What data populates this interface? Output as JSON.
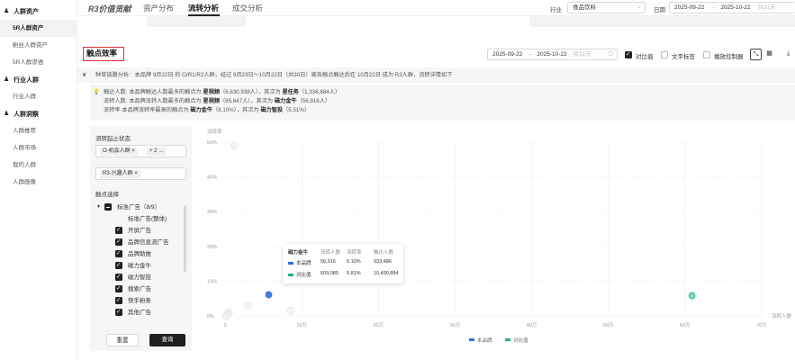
{
  "sidebar": {
    "groups": [
      {
        "label": "人群资产",
        "items": [
          "5R人群资产",
          "粉丝人群资产",
          "5R人群渗透"
        ]
      },
      {
        "label": "行业人群",
        "items": [
          "行业人群"
        ]
      },
      {
        "label": "人群洞察",
        "items": [
          "人群推荐",
          "人群市场",
          "我的人群",
          "人群画像"
        ]
      }
    ],
    "active_item": "5R人群资产"
  },
  "topbar": {
    "brand": "R3价值贡献",
    "tabs": [
      "资产分布",
      "流转分析",
      "成交分析"
    ],
    "active_tab": "流转分析",
    "industry_label": "行业",
    "industry_value": "食品饮料",
    "date_label": "日期",
    "date_start": "2025-09-22",
    "date_sep": "→",
    "date_end": "2025-10-22",
    "date_days": "共31天"
  },
  "section": {
    "title": "触点效率",
    "range_start": "2025-09-22",
    "range_end": "2025-10-22",
    "range_days": "共31天",
    "compare_label": "对比值",
    "text_tag_label": "文字标签",
    "zoom_label": "播放控制器"
  },
  "path_line": {
    "prefix": "种草链路分析:",
    "text": "本品牌 9月22日 的 O/R1/R2人群，经过 9月23日～10月22日（共30日）被各触点触达后在 10月22日 成为 R3人群，流转详情如下"
  },
  "insights": {
    "line1_label": "触达人数:",
    "line1_text": "本品牌触达人数最多的触点为",
    "line1_top": "星視频",
    "line1_top_val": "（6,830,938人）",
    "line1_mid": "，其次为",
    "line1_second": "星任务",
    "line1_second_val": "（1,336,684人）",
    "line2_label": "流转人数:",
    "line2_text": "本品牌流转人数最多的触点为",
    "line2_top": "星視频",
    "line2_top_val": "（85,647人）",
    "line2_mid": "，其次为",
    "line2_second": "磁力金牛",
    "line2_second_val": "（56,916人）",
    "line3_label": "流转率",
    "line3_text": "本品牌流转率最高的触点为",
    "line3_top": "磁力金牛",
    "line3_top_val": "（6.10%）",
    "line3_mid": "，其次为",
    "line3_second": "磁力智投",
    "line3_second_val": "（5.51%）"
  },
  "filters": {
    "start_state_label": "流转起止状态",
    "start_tags": [
      "O-机会人群 ×",
      "+ 2 ..."
    ],
    "end_tags": [
      "R3-兴趣人群 ×"
    ],
    "touch_label": "触点选择",
    "tree_root": "标准广告（8/9）",
    "tree_items": [
      {
        "label": "标准广告(整体)",
        "checked": false
      },
      {
        "label": "开屏广告",
        "checked": true
      },
      {
        "label": "品牌信息流广告",
        "checked": true
      },
      {
        "label": "品牌助推",
        "checked": true
      },
      {
        "label": "磁力金牛",
        "checked": true
      },
      {
        "label": "磁力智投",
        "checked": true
      },
      {
        "label": "搜索广告",
        "checked": true
      },
      {
        "label": "快手粉条",
        "checked": true
      },
      {
        "label": "其他广告",
        "checked": true
      }
    ],
    "reset_label": "重置",
    "query_label": "查询"
  },
  "tooltip": {
    "title": "磁力金牛",
    "headers": [
      "流转人数",
      "流转率",
      "触达人数"
    ],
    "rows": [
      {
        "name": "本品牌",
        "values": [
          "56,916",
          "6.10%",
          "933,486"
        ],
        "color": "#2f6fe0"
      },
      {
        "name": "对比值",
        "values": [
          "609,085",
          "5.81%",
          "10,490,884"
        ],
        "color": "#22b573"
      }
    ]
  },
  "chart_data": {
    "type": "scatter",
    "ylabel": "流转率",
    "xlabel": "流转人数",
    "y_ticks": [
      "50%",
      "40%",
      "30%",
      "20%",
      "10%",
      "0%"
    ],
    "x_ticks": [
      "0",
      "10万",
      "20万",
      "30万",
      "40万",
      "50万",
      "60万",
      "70万"
    ],
    "xlim": [
      0,
      700000
    ],
    "ylim": [
      0,
      0.5
    ],
    "series": [
      {
        "name": "本品牌",
        "color": "#2f6fe0",
        "points": [
          [
            56916,
            0.061
          ],
          [
            12000,
            0.49
          ],
          [
            30000,
            0.03
          ],
          [
            85647,
            0.015
          ],
          [
            5000,
            0.01
          ],
          [
            3000,
            0.005
          ]
        ]
      },
      {
        "name": "对比值",
        "color": "#22b573",
        "points": [
          [
            609085,
            0.0581
          ],
          [
            2000,
            0.0
          ]
        ]
      }
    ],
    "legend": [
      "本品牌",
      "对比值"
    ]
  }
}
